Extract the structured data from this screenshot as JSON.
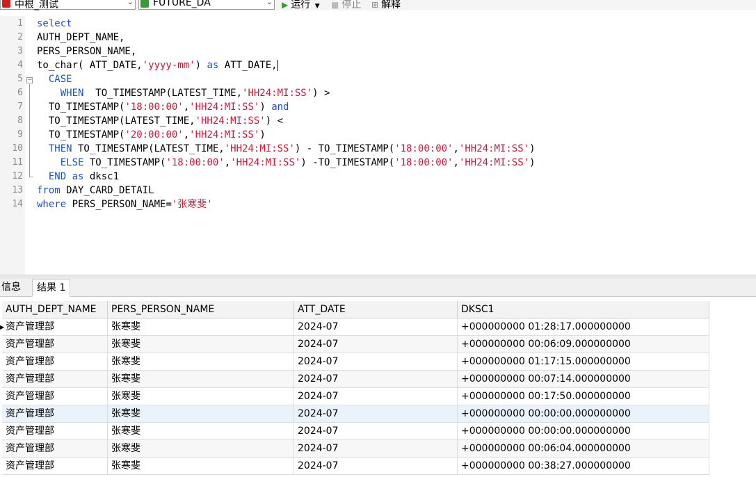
{
  "toolbar": {
    "connection": "中根_测试",
    "schema": "FUTURE_DA",
    "run": "运行",
    "stop": "停止",
    "explain": "解释"
  },
  "editor": {
    "lines": [
      {
        "n": "1",
        "t": [
          [
            "kw",
            "select"
          ]
        ]
      },
      {
        "n": "2",
        "t": [
          [
            "",
            "AUTH_DEPT_NAME,"
          ]
        ]
      },
      {
        "n": "3",
        "t": [
          [
            "",
            "PERS_PERSON_NAME,"
          ]
        ]
      },
      {
        "n": "4",
        "t": [
          [
            "",
            "to_char( ATT_DATE,"
          ],
          [
            "st",
            "'yyyy-mm'"
          ],
          [
            "",
            ") "
          ],
          [
            "kw",
            "as"
          ],
          [
            "",
            ". ATT_DATE,"
          ]
        ]
      },
      {
        "n": "5",
        "t": [
          [
            "",
            "  "
          ],
          [
            "kw",
            "CASE"
          ]
        ]
      },
      {
        "n": "6",
        "t": [
          [
            "",
            "    "
          ],
          [
            "kw",
            "WHEN"
          ],
          [
            "",
            "  TO_TIMESTAMP(LATEST_TIME,"
          ],
          [
            "st",
            "'HH24:MI:SS'"
          ],
          [
            "",
            ") >"
          ]
        ]
      },
      {
        "n": "7",
        "t": [
          [
            "",
            "  TO_TIMESTAMP("
          ],
          [
            "st",
            "'18:00:00'"
          ],
          [
            "",
            ","
          ],
          [
            "st",
            "'HH24:MI:SS'"
          ],
          [
            "",
            ") "
          ],
          [
            "kw",
            "and"
          ]
        ]
      },
      {
        "n": "8",
        "t": [
          [
            "",
            "  TO_TIMESTAMP(LATEST_TIME,"
          ],
          [
            "st",
            "'HH24:MI:SS'"
          ],
          [
            "",
            ") <"
          ]
        ]
      },
      {
        "n": "9",
        "t": [
          [
            "",
            "  TO_TIMESTAMP("
          ],
          [
            "st",
            "'20:00:00'"
          ],
          [
            "",
            ","
          ],
          [
            "st",
            "'HH24:MI:SS'"
          ],
          [
            "",
            ")"
          ]
        ]
      },
      {
        "n": "10",
        "t": [
          [
            "",
            "  "
          ],
          [
            "kw",
            "THEN"
          ],
          [
            "",
            ". TO_TIMESTAMP(LATEST_TIME,"
          ],
          [
            "st",
            "'HH24:MI:SS'"
          ],
          [
            "",
            ") - TO_TIMESTAMP("
          ],
          [
            "st",
            "'18:00:00'"
          ],
          [
            "",
            ","
          ],
          [
            "st",
            "'HH24:MI:SS'"
          ],
          [
            "",
            ")"
          ]
        ]
      },
      {
        "n": "11",
        "t": [
          [
            "",
            "    "
          ],
          [
            "kw",
            "ELSE"
          ],
          [
            "",
            ". TO_TIMESTAMP("
          ],
          [
            "st",
            "'18:00:00'"
          ],
          [
            "",
            ","
          ],
          [
            "st",
            "'HH24:MI:SS'"
          ],
          [
            "",
            ") -TO_TIMESTAMP("
          ],
          [
            "st",
            "'18:00:00'"
          ],
          [
            "",
            ","
          ],
          [
            "st",
            "'HH24:MI:SS'"
          ],
          [
            "",
            ")"
          ]
        ]
      },
      {
        "n": "12",
        "t": [
          [
            "",
            "  "
          ],
          [
            "kw",
            "END"
          ],
          [
            "",
            ". "
          ],
          [
            "kw",
            "as"
          ],
          [
            "",
            ". dksc1"
          ]
        ]
      },
      {
        "n": "13",
        "t": [
          [
            "kw",
            "from"
          ],
          [
            "",
            ". DAY_CARD_DETAIL"
          ]
        ]
      },
      {
        "n": "14",
        "t": [
          [
            "kw",
            "where"
          ],
          [
            "",
            ". PERS_PERSON_NAME="
          ],
          [
            "st",
            "'张寒斐'"
          ]
        ]
      }
    ]
  },
  "tabs": [
    "信息",
    "结果 1"
  ],
  "grid": {
    "columns": [
      "AUTH_DEPT_NAME",
      "PERS_PERSON_NAME",
      "ATT_DATE",
      "DKSC1"
    ],
    "rows": [
      [
        "资产管理部",
        "张寒斐",
        "2024-07",
        "+000000000 01:28:17.000000000"
      ],
      [
        "资产管理部",
        "张寒斐",
        "2024-07",
        "+000000000 00:06:09.000000000"
      ],
      [
        "资产管理部",
        "张寒斐",
        "2024-07",
        "+000000000 01:17:15.000000000"
      ],
      [
        "资产管理部",
        "张寒斐",
        "2024-07",
        "+000000000 00:07:14.000000000"
      ],
      [
        "资产管理部",
        "张寒斐",
        "2024-07",
        "+000000000 00:17:50.000000000"
      ],
      [
        "资产管理部",
        "张寒斐",
        "2024-07",
        "+000000000 00:00:00.000000000"
      ],
      [
        "资产管理部",
        "张寒斐",
        "2024-07",
        "+000000000 00:00:00.000000000"
      ],
      [
        "资产管理部",
        "张寒斐",
        "2024-07",
        "+000000000 00:06:04.000000000"
      ],
      [
        "资产管理部",
        "张寒斐",
        "2024-07",
        "+000000000 00:38:27.000000000"
      ]
    ]
  },
  "colors": {
    "keyword": "#1a4fd6",
    "string": "#d11636",
    "run_icon": "#2fa12f",
    "connection_icon": "#d01c1c",
    "schema_icon": "#3a9a3a"
  }
}
